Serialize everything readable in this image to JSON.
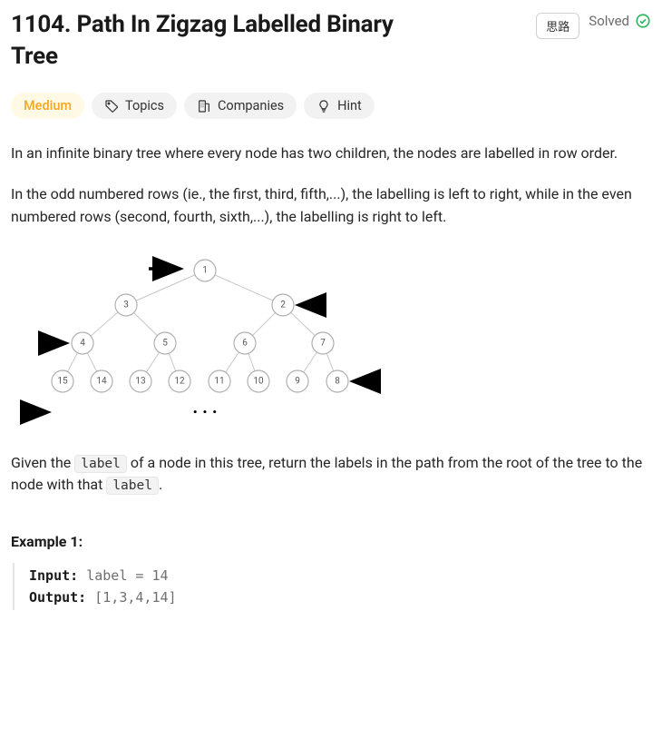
{
  "problem": {
    "number": "1104",
    "title": "Path In Zigzag Labelled Binary Tree",
    "full_title": "1104. Path In Zigzag Labelled Binary Tree",
    "solved_label": "Solved",
    "cn_button": "思路",
    "difficulty": "Medium"
  },
  "chips": {
    "topics": "Topics",
    "companies": "Companies",
    "hint": "Hint"
  },
  "description": {
    "p1": "In an infinite binary tree where every node has two children, the nodes are labelled in row order.",
    "p2": "In the odd numbered rows (ie., the first, third, fifth,...), the labelling is left to right, while in the even numbered rows (second, fourth, sixth,...), the labelling is right to left.",
    "p3a": "Given the ",
    "code1": "label",
    "p3b": " of a node in this tree, return the labels in the path from the root of the tree to the node with that ",
    "code2": "label",
    "p3c": "."
  },
  "tree": {
    "row1": [
      1
    ],
    "row2": [
      3,
      2
    ],
    "row3": [
      4,
      5,
      6,
      7
    ],
    "row4": [
      15,
      14,
      13,
      12,
      11,
      10,
      9,
      8
    ],
    "ellipsis": ". . ."
  },
  "example1": {
    "heading": "Example 1:",
    "input_label": "Input:",
    "input_value": "label = 14",
    "output_label": "Output:",
    "output_value": "[1,3,4,14]"
  }
}
